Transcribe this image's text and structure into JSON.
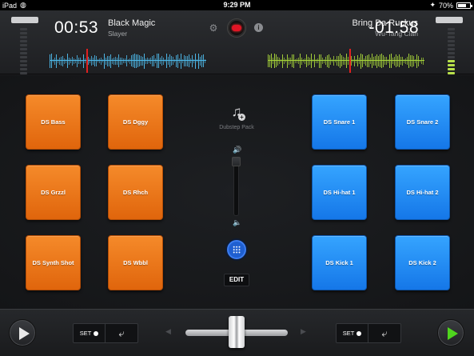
{
  "status_bar": {
    "device": "iPad",
    "time": "9:29 PM",
    "battery": "70%",
    "battery_level": 0.7
  },
  "deck_left": {
    "time": "00:53",
    "title": "Black Magic",
    "artist": "Slayer",
    "wave_color": "#4db8e8"
  },
  "deck_right": {
    "time": "-01:58",
    "title": "Bring Da Ruckus",
    "artist": "Wu-Tang Clan",
    "wave_color": "#a6d43a"
  },
  "sampler": {
    "pack_name": "Dubstep Pack",
    "edit_label": "EDIT",
    "left_pads": [
      "DS Bass",
      "DS Dggy",
      "DS Grzzl",
      "DS Rhch",
      "DS Synth Shot",
      "DS Wbbl"
    ],
    "right_pads": [
      "DS Snare 1",
      "DS Snare 2",
      "DS Hi-hat 1",
      "DS Hi-hat 2",
      "DS Kick 1",
      "DS Kick 2"
    ]
  },
  "footer": {
    "set_label_left": "SET",
    "set_label_right": "SET"
  },
  "colors": {
    "pad_orange": "#f07a1c",
    "pad_blue": "#2590f5",
    "record": "#e01525",
    "play_right": "#4fd51e"
  },
  "icons": {
    "settings": "gear-icon",
    "record": "record-icon",
    "info": "info-icon",
    "sample_pack": "music-note-plus-icon",
    "volume": "speaker-icon",
    "grid": "grid-icon",
    "play": "play-icon",
    "loop": "loop-arrow-icon"
  }
}
